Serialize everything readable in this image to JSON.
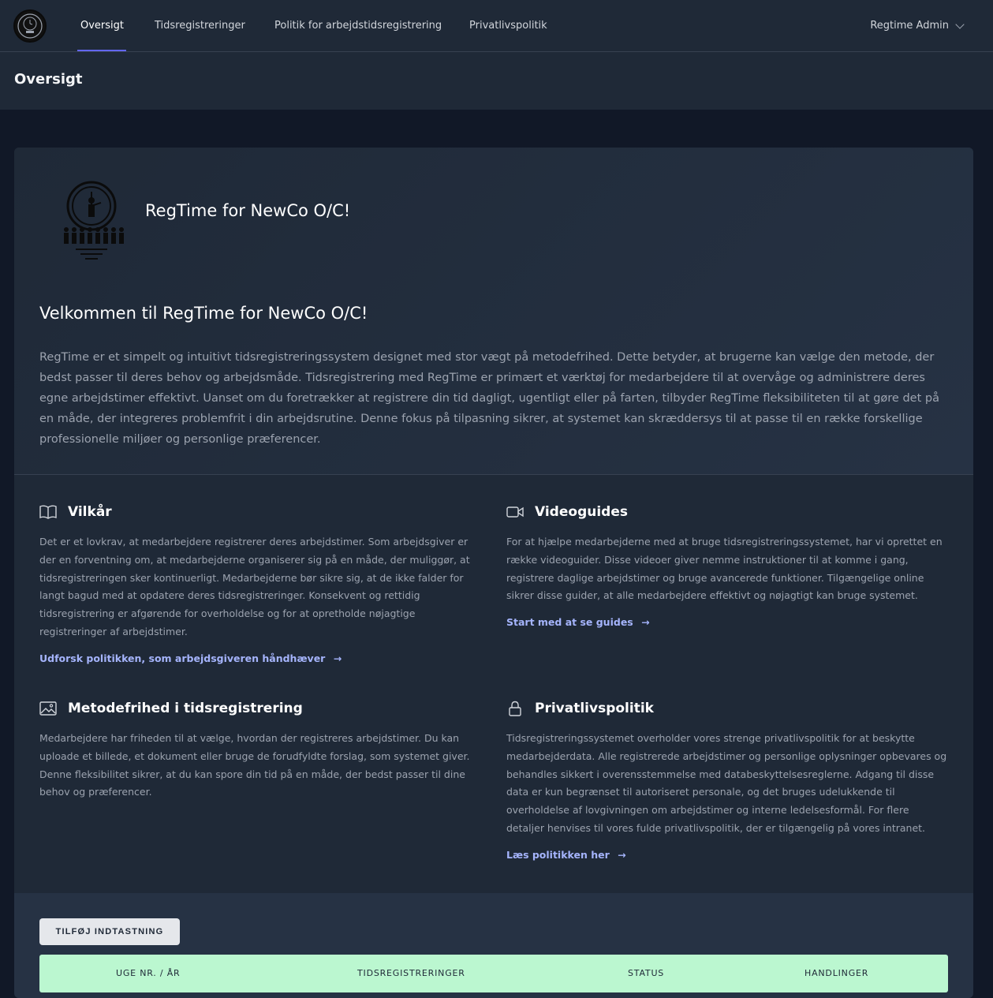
{
  "nav": {
    "logo_icon": "regtime-clock-logo",
    "links": [
      "Oversigt",
      "Tidsregistreringer",
      "Politik for arbejdstidsregistrering",
      "Privatlivspolitik"
    ],
    "active": "Oversigt",
    "user": "Regtime Admin",
    "accent_color": "#6366f1"
  },
  "page": {
    "title": "Oversigt"
  },
  "hero": {
    "org_title": "RegTime for NewCo O/C!",
    "welcome": "Velkommen til RegTime for NewCo O/C!",
    "intro": "RegTime er et simpelt og intuitivt tidsregistreringssystem designet med stor vægt på metodefrihed. Dette betyder, at brugerne kan vælge den metode, der bedst passer til deres behov og arbejdsmåde. Tidsregistrering med RegTime er primært et værktøj for medarbejdere til at overvåge og administrere deres egne arbejdstimer effektivt. Uanset om du foretrækker at registrere din tid dagligt, ugentligt eller på farten, tilbyder RegTime fleksibiliteten til at gøre det på en måde, der integreres problemfrit i din arbejdsrutine. Denne fokus på tilpasning sikrer, at systemet kan skræddersys til at passe til en række forskellige professionelle miljøer og personlige præferencer."
  },
  "sections": {
    "vilkar": {
      "icon": "book-icon",
      "title": "Vilkår",
      "body": "Det er et lovkrav, at medarbejdere registrerer deres arbejdstimer. Som arbejdsgiver er der en forventning om, at medarbejderne organiserer sig på en måde, der muliggør, at tidsregistreringen sker kontinuerligt. Medarbejderne bør sikre sig, at de ikke falder for langt bagud med at opdatere deres tidsregistreringer. Konsekvent og rettidig tidsregistrering er afgørende for overholdelse og for at opretholde nøjagtige registreringer af arbejdstimer.",
      "link": "Udforsk politikken, som arbejdsgiveren håndhæver"
    },
    "videoguides": {
      "icon": "video-camera-icon",
      "title": "Videoguides",
      "body": "For at hjælpe medarbejderne med at bruge tidsregistreringssystemet, har vi oprettet en række videoguider. Disse videoer giver nemme instruktioner til at komme i gang, registrere daglige arbejdstimer og bruge avancerede funktioner. Tilgængelige online sikrer disse guider, at alle medarbejdere effektivt og nøjagtigt kan bruge systemet.",
      "link": "Start med at se guides"
    },
    "metodefrihed": {
      "icon": "image-icon",
      "title": "Metodefrihed i tidsregistrering",
      "body": "Medarbejdere har friheden til at vælge, hvordan der registreres arbejdstimer. Du kan uploade et billede, et dokument eller bruge de forudfyldte forslag, som systemet giver. Denne fleksibilitet sikrer, at du kan spore din tid på en måde, der bedst passer til dine behov og præferencer."
    },
    "privatliv": {
      "icon": "lock-icon",
      "title": "Privatlivspolitik",
      "body": "Tidsregistreringssystemet overholder vores strenge privatlivspolitik for at beskytte medarbejderdata. Alle registrerede arbejdstimer og personlige oplysninger opbevares og behandles sikkert i overensstemmelse med databeskyttelsesreglerne. Adgang til disse data er kun begrænset til autoriseret personale, og det bruges udelukkende til overholdelse af lovgivningen om arbejdstimer og interne ledelsesformål. For flere detaljer henvises til vores fulde privatlivspolitik, der er tilgængelig på vores intranet.",
      "link": "Læs politikken her"
    }
  },
  "actions": {
    "add_entry": "TILFØJ INDTASTNING"
  },
  "table": {
    "headers": [
      "UGE NR. / ÅR",
      "TIDSREGISTRERINGER",
      "STATUS",
      "HANDLINGER"
    ],
    "header_color": "#bbf7d0"
  },
  "link_arrow": "→"
}
